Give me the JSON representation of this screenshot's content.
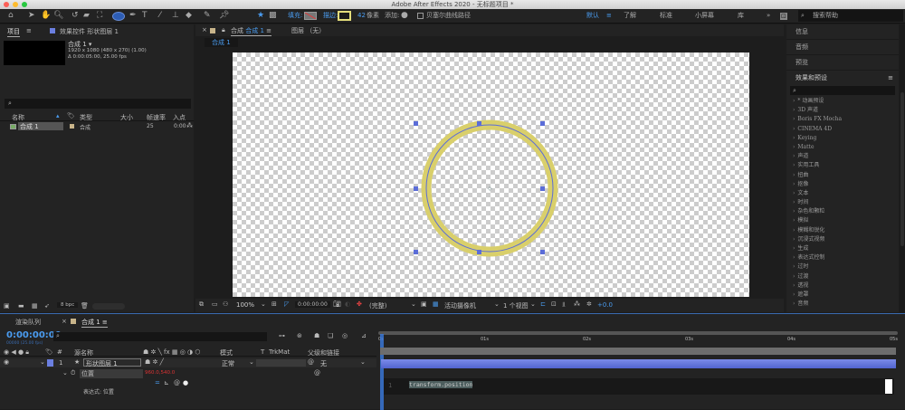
{
  "window": {
    "title": "Adobe After Effects 2020 - 无标题项目 *"
  },
  "toolbar": {
    "fill_label": "填充:",
    "stroke_label": "描边:",
    "stroke_width": "42",
    "stroke_unit": "像素",
    "add_label": "添加:",
    "bezier_label": "贝塞尔曲线路径",
    "workspaces": [
      "默认",
      "了解",
      "标准",
      "小屏幕",
      "库"
    ],
    "search_placeholder": "搜索帮助",
    "accent": "#4a9cf0"
  },
  "project": {
    "tab": "项目",
    "effects_tab": "效果控件 形状图层 1",
    "comp_name": "合成 1 ▾",
    "comp_info1": "1920 x 1080  (480 x 270) (1.00)",
    "comp_info2": "Δ 0:00:05:00, 25.00 fps",
    "columns": [
      "名称",
      "类型",
      "大小",
      "帧速率",
      "入点"
    ],
    "items": [
      {
        "name": "合成 1",
        "type": "合成",
        "fps": "25",
        "in": "0:00"
      }
    ],
    "bpc": "8 bpc"
  },
  "composition": {
    "tab": "合成",
    "tab_name": "合成 1",
    "layer_tab": "图层 （无）",
    "subtab": "合成 1",
    "zoom": "100%",
    "timecode": "0:00:00:00",
    "resolution": "(完整)",
    "camera": "活动摄像机",
    "views": "1 个视图",
    "exposure": "+0.0",
    "shape_color": "#d9cf6b"
  },
  "right_panel": {
    "items": [
      "信息",
      "音频",
      "预览"
    ],
    "effects_title": "效果和预设",
    "effects": [
      "* 动画预设",
      "3D 声道",
      "Boris FX Mocha",
      "CINEMA 4D",
      "Keying",
      "Matte",
      "声道",
      "实用工具",
      "扭曲",
      "抠像",
      "文本",
      "时间",
      "杂色和颗粒",
      "模拟",
      "模糊和锐化",
      "沉浸式视频",
      "生成",
      "表达式控制",
      "过时",
      "过渡",
      "透视",
      "遮罩",
      "音频"
    ]
  },
  "timeline": {
    "render_tab": "渲染队列",
    "comp_tab": "合成 1",
    "current_time": "0:00:00:00",
    "frame_info": "00000 (25.00 fps)",
    "columns": {
      "num": "#",
      "source": "源名称",
      "mode": "模式",
      "t": "T",
      "trkmat": "TrkMat",
      "parent": "父级和链接"
    },
    "layer": {
      "num": "1",
      "name": "形状图层 1",
      "mode": "正常",
      "parent": "无"
    },
    "property": {
      "name": "位置",
      "value": "960.0,540.0"
    },
    "expression_label": "表达式: 位置",
    "expression_line": "1",
    "expression": "transform.position",
    "ruler": [
      "0s",
      "01s",
      "02s",
      "03s",
      "04s",
      "05s"
    ]
  }
}
